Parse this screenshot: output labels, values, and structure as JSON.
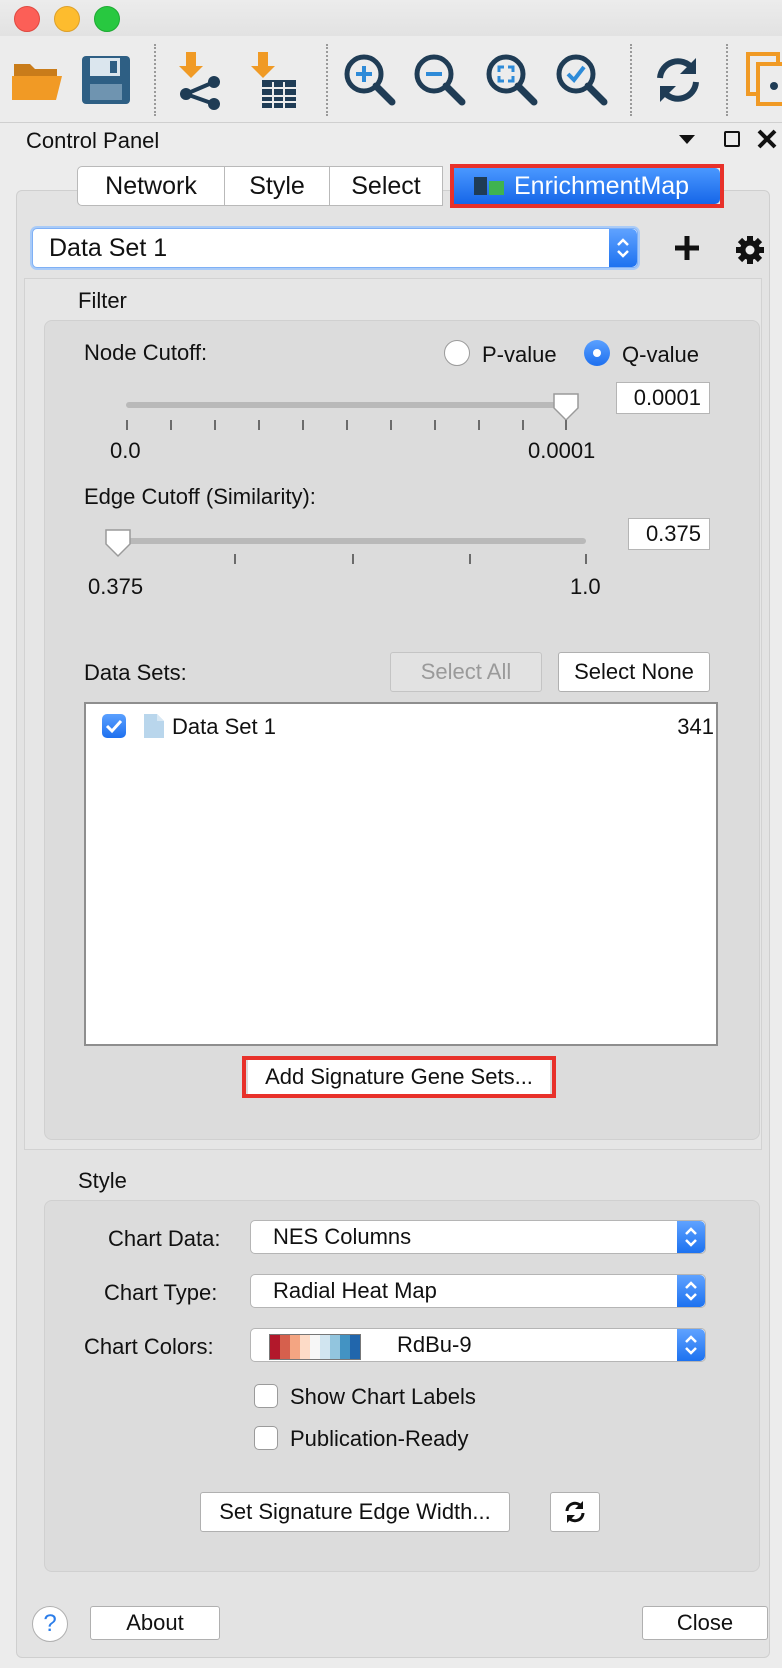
{
  "window": {
    "traffic_lights": {
      "close": "#fc5f57",
      "minimize": "#fdbc2e",
      "zoom": "#28c840"
    }
  },
  "toolbar": {
    "icons": [
      "open-folder-icon",
      "save-icon",
      "import-network-icon",
      "import-table-icon",
      "zoom-in-icon",
      "zoom-out-icon",
      "zoom-fit-icon",
      "zoom-selected-icon",
      "refresh-icon",
      "copy-network-icon"
    ]
  },
  "control_panel": {
    "title": "Control Panel"
  },
  "tabs": [
    {
      "label": "Network",
      "selected": false
    },
    {
      "label": "Style",
      "selected": false
    },
    {
      "label": "Select",
      "selected": false
    },
    {
      "label": "EnrichmentMap",
      "selected": true
    }
  ],
  "dataset_select": {
    "value": "Data Set 1"
  },
  "filter": {
    "section_title": "Filter",
    "node_cutoff": {
      "label": "Node Cutoff:",
      "options": [
        "P-value",
        "Q-value"
      ],
      "selected": "Q-value",
      "value": "0.0001",
      "slider_min_label": "0.0",
      "slider_max_label": "0.0001",
      "slider_position": 1.0
    },
    "edge_cutoff": {
      "label": "Edge Cutoff (Similarity):",
      "value": "0.375",
      "slider_min_label": "0.375",
      "slider_max_label": "1.0",
      "slider_position": 0.0
    },
    "data_sets": {
      "label": "Data Sets:",
      "select_all": "Select All",
      "select_none": "Select None",
      "items": [
        {
          "name": "Data Set 1",
          "count": "341",
          "checked": true
        }
      ]
    },
    "add_signature_button": "Add Signature Gene Sets..."
  },
  "style": {
    "section_title": "Style",
    "chart_data": {
      "label": "Chart Data:",
      "value": "NES Columns"
    },
    "chart_type": {
      "label": "Chart Type:",
      "value": "Radial Heat Map"
    },
    "chart_colors": {
      "label": "Chart Colors:",
      "value": "RdBu-9",
      "swatches": [
        "#b2182b",
        "#d6604d",
        "#f4a582",
        "#fddbc7",
        "#f7f7f7",
        "#d1e5f0",
        "#92c5de",
        "#4393c3",
        "#2166ac"
      ]
    },
    "show_chart_labels": {
      "label": "Show Chart Labels",
      "checked": false
    },
    "publication_ready": {
      "label": "Publication-Ready",
      "checked": false
    },
    "set_edge_width_button": "Set Signature Edge Width..."
  },
  "footer": {
    "help": "?",
    "about": "About",
    "close": "Close"
  },
  "colors": {
    "accent": "#1f76f5",
    "highlight_border": "#e8312a"
  }
}
